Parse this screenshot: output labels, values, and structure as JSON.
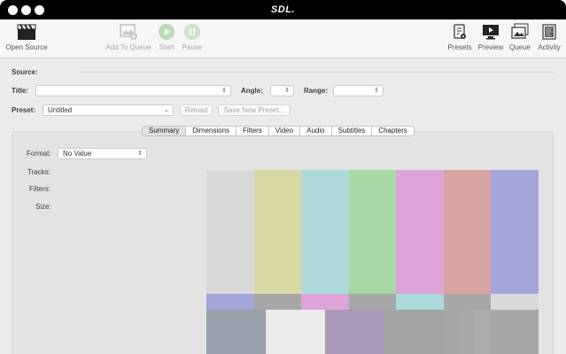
{
  "window": {
    "title": "SDL."
  },
  "toolbar": {
    "open_source": "Open Source",
    "add_to_queue": "Add To Queue",
    "start": "Start",
    "pause": "Pause",
    "presets": "Presets",
    "preview": "Preview",
    "queue": "Queue",
    "activity": "Activity"
  },
  "source": {
    "label": "Source:"
  },
  "title_row": {
    "title_label": "Title:",
    "title_value": "",
    "angle_label": "Angle:",
    "angle_value": "",
    "range_label": "Range:",
    "range_value": ""
  },
  "preset_row": {
    "label": "Preset:",
    "value": "Untitled",
    "reload": "Reload",
    "save_new": "Save New Preset..."
  },
  "tabs": [
    "Summary",
    "Dimensions",
    "Filters",
    "Video",
    "Audio",
    "Subtitles",
    "Chapters"
  ],
  "summary": {
    "format_label": "Format:",
    "format_value": "No Value",
    "tracks_label": "Tracks:",
    "filters_label": "Filters:",
    "size_label": "Size:"
  },
  "colors": {
    "titlebar": "#000000",
    "bar_colors": [
      "#d9d9d9",
      "#d8d8a4",
      "#acdada",
      "#a8d9a5",
      "#dca4d8",
      "#d9a4a4",
      "#a2a6d8"
    ]
  }
}
